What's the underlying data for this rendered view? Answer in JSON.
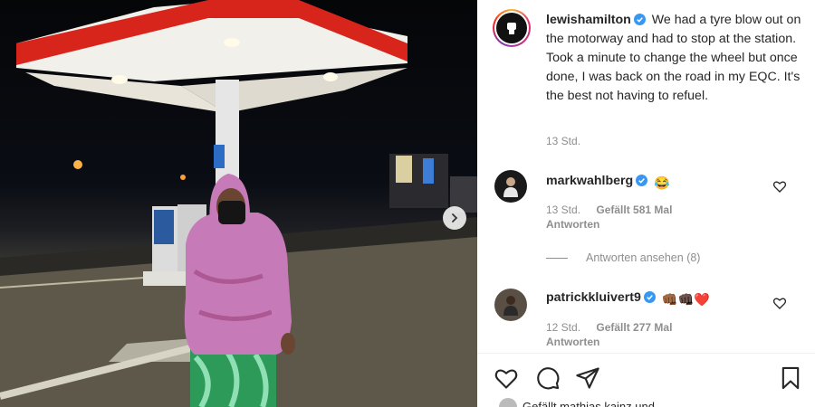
{
  "post": {
    "author": "lewishamilton",
    "caption": "We had a tyre blow out on the motorway and had to stop at the station. Took a minute to change the wheel but once done, I was back on the road in my EQC. It's the best not having to refuel.",
    "time": "13 Std."
  },
  "comments": [
    {
      "user": "markwahlberg",
      "emoji": "😂",
      "time": "13 Std.",
      "likes": "Gefällt 581 Mal",
      "reply": "Antworten",
      "view_replies": "Antworten ansehen (8)"
    },
    {
      "user": "patrickkluivert9",
      "emoji": "👊🏾👊🏿❤️",
      "time": "12 Std.",
      "likes": "Gefällt 277 Mal",
      "reply": "Antworten"
    }
  ],
  "liked_by_peek": "Gefällt mathias.kainz und",
  "icons": {
    "verified": "verified-badge-icon",
    "like": "heart-icon",
    "comment": "comment-icon",
    "share": "paper-plane-icon",
    "save": "bookmark-icon",
    "next": "chevron-right-icon"
  },
  "colors": {
    "verified_blue": "#3897f0",
    "canopy_red": "#d8251c",
    "hoodie_pink": "#c67bb8",
    "pants_green": "#2e9a5a"
  }
}
